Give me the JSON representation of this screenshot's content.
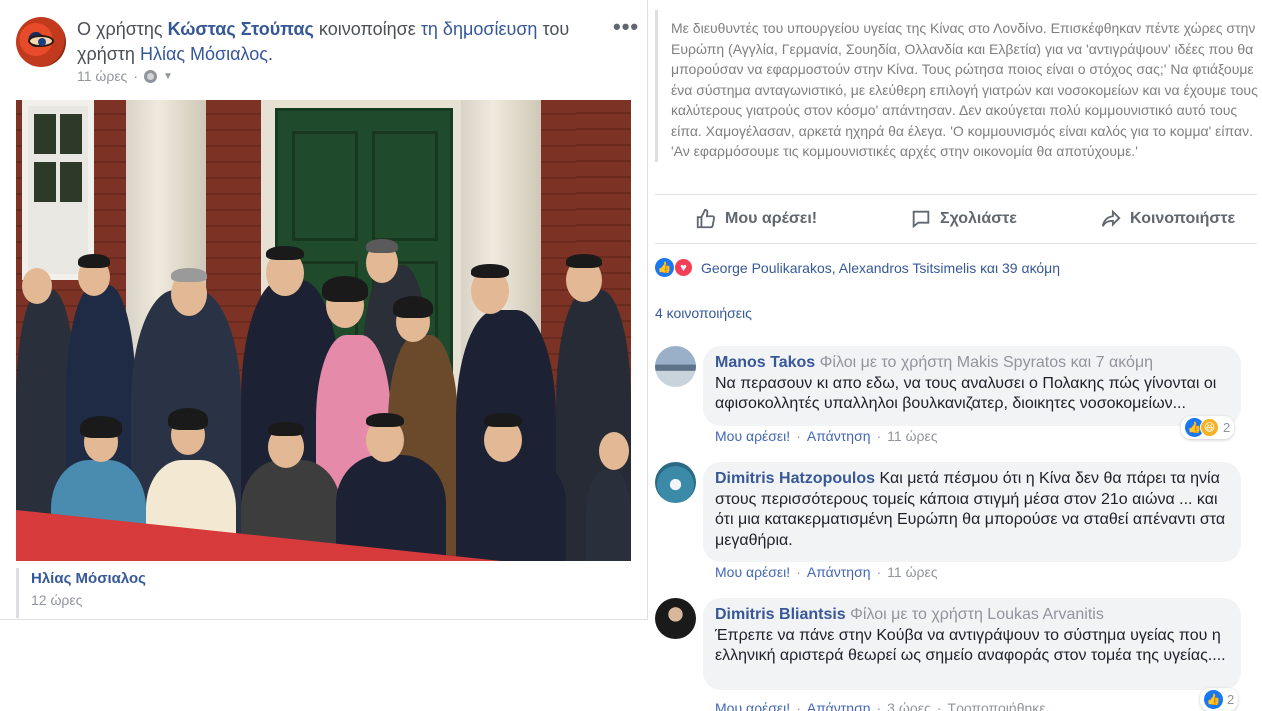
{
  "post": {
    "prefix": "Ο χρήστης",
    "sharer": "Κώστας Στούπας",
    "verb": "κοινοποίησε",
    "shared_link": "τη δημοσίευση",
    "of_user": "του",
    "user_word": "χρήστη",
    "author": "Ηλίας Μόσιαλος",
    "period": ".",
    "time": "11 ώρες",
    "more_label": "•••",
    "shared_from_name": "Ηλίας Μόσιαλος",
    "shared_from_time": "12 ώρες"
  },
  "quote": {
    "text": "Με διευθυντές του υπουργείου υγείας της Κίνας στο Λονδίνο. Επισκέφθηκαν πέντε χώρες στην Ευρώπη (Αγγλία, Γερμανία, Σουηδία, Ολλανδία και Ελβετία) για να 'αντιγράψουν' ιδέες που θα μπορούσαν να εφαρμοστούν στην Κίνα. Τους ρώτησα ποιος είναι ο στόχος σας;' Να φτιάξουμε ένα σύστημα ανταγωνιστικό, με ελεύθερη επιλογή γιατρών και νοσοκομείων και να έχουμε τους καλύτερους γιατρούς στον κόσμο' απάντησαν. Δεν ακούγεται πολύ κομμουνιστικό αυτό τους είπα. Χαμογέλασαν, αρκετά ηχηρά θα έλεγα. 'Ο κομμουνισμός είναι καλός για το κομμα' είπαν. 'Αν εφαρμόσουμε τις κομμουνιστικές αρχές στην οικονομία θα αποτύχουμε.'"
  },
  "actions": {
    "like": "Μου αρέσει!",
    "comment": "Σχολιάστε",
    "share": "Κοινοποιήστε"
  },
  "reactions_summary": "George Poulikarakos, Alexandros Tsitsimelis και 39 ακόμη",
  "shares_count": "4 κοινοποιήσεις",
  "comments": [
    {
      "name": "Manos Takos",
      "friends": "Φίλοι με το χρήστη Makis Spyratos και 7 ακόμη",
      "text": "Να περασουν κι απο εδω, να τους αναλυσει ο Πολακης πώς γίνονται οι αφισοκολλητές υπαλληλοι βουλκανιζατερ, διοικητες νοσοκομείων...",
      "like": "Μου αρέσει!",
      "reply": "Απάντηση",
      "time": "11 ώρες",
      "sep": "·",
      "reaction_count": "2"
    },
    {
      "name": "Dimitris Hatzopoulos",
      "friends": "",
      "text": "Και μετά πέσμου ότι η Κίνα δεν θα πάρει τα ηνία στους περισσότερους τομείς κάποια στιγμή μέσα στον 21ο αιώνα ... και ότι μια κατακερματισμένη Ευρώπη θα μπορούσε να σταθεί απέναντι στα μεγαθήρια.",
      "like": "Μου αρέσει!",
      "reply": "Απάντηση",
      "time": "11 ώρες",
      "sep": "·"
    },
    {
      "name": "Dimitris Bliantsis",
      "friends": "Φίλοι με το χρήστη Loukas Arvanitis",
      "text": "Έπρεπε να πάνε στην Κούβα να αντιγράψουν το σύστημα υγείας που η ελληνική αριστερά θεωρεί ως σημείο αναφοράς στον τομέα της υγείας....",
      "like": "Μου αρέσει!",
      "reply": "Απάντηση",
      "time": "3 ώρες",
      "edited": "Τροποποιήθηκε",
      "sep": "·",
      "reaction_count": "2"
    }
  ],
  "icons": {
    "like": "thumbs-up-icon",
    "comment": "speech-bubble-icon",
    "share": "share-arrow-icon",
    "globe": "globe-icon"
  },
  "colors": {
    "link": "#365899",
    "meta": "#90949c",
    "like_blue": "#1877f2",
    "love_red": "#f33e58",
    "bubble": "#f2f3f5"
  }
}
